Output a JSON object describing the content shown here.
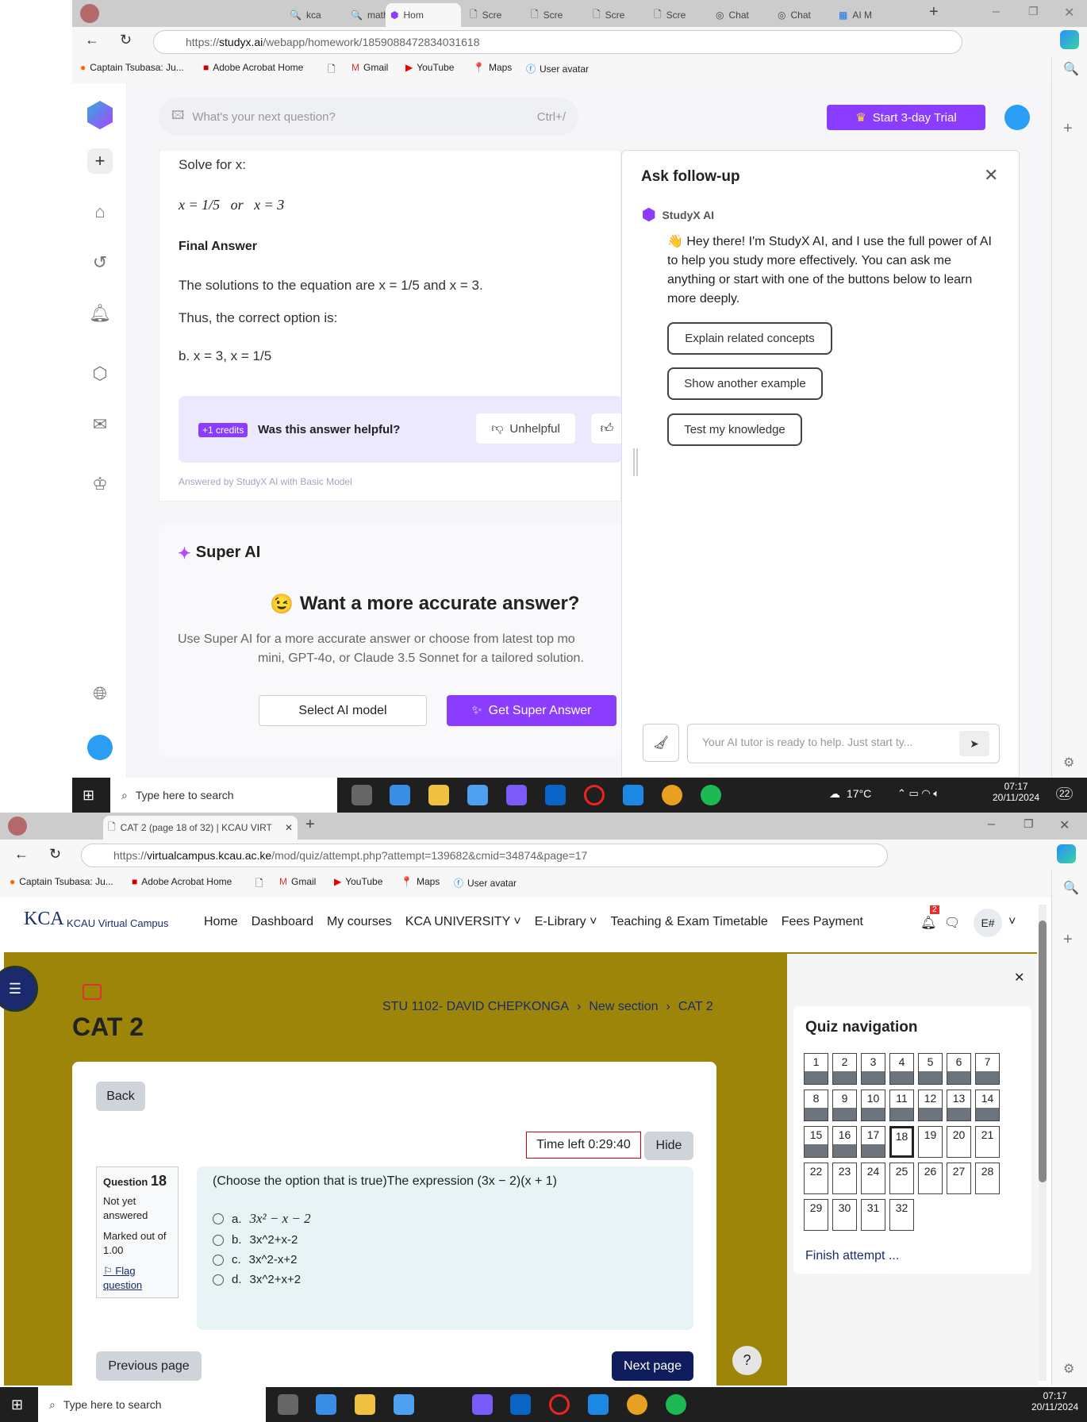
{
  "top_browser": {
    "tabs": [
      "",
      "kca",
      "math",
      "Hom",
      "Scre",
      "Scre",
      "Scre",
      "Scre",
      "Chat",
      "Chat",
      "AI M"
    ],
    "url_prefix": "https://",
    "url_domain": "studyx.ai",
    "url_path": "/webapp/homework/1859088472834031618",
    "bookmarks": [
      "Captain Tsubasa: Ju...",
      "Adobe Acrobat Home",
      "",
      "Gmail",
      "YouTube",
      "Maps",
      "User avatar"
    ]
  },
  "studyx": {
    "search_placeholder": "What's your next question?",
    "search_shortcut": "Ctrl+/",
    "trial_button": "Start 3-day Trial",
    "solve_for": "Solve for x:",
    "solutions_eq": "x = 1/5   or   x = 3",
    "final_answer_heading": "Final Answer",
    "solutions_text": "The solutions to the equation are x = 1/5 and x = 3.",
    "thus_text": "Thus, the correct option is:",
    "option_text": "b. x = 3, x = 1/5",
    "credits_badge": "+1 credits",
    "helpful_question": "Was this answer helpful?",
    "unhelpful_button": "Unhelpful",
    "answered_by": "Answered by StudyX AI with Basic Model",
    "super_ai_title": "Super AI",
    "accurate_heading": "Want a more accurate answer?",
    "super_desc_1": "Use Super AI for a more accurate answer or choose from latest top mo",
    "super_desc_2": "mini, GPT-4o, or Claude 3.5 Sonnet for a tailored solution.",
    "select_model_button": "Select AI model",
    "get_super_button": "Get Super Answer",
    "followup": {
      "title": "Ask follow-up",
      "bot_name": "StudyX AI",
      "message": "Hey there! I'm StudyX AI, and I use the full power of AI to help you study more effectively. You can ask me anything or start with one of the buttons below to learn more deeply.",
      "suggestions": [
        "Explain related concepts",
        "Show another example",
        "Test my knowledge"
      ],
      "input_placeholder": "Your AI tutor is ready to help. Just start ty..."
    },
    "accent": "#8b3dff"
  },
  "taskbar": {
    "search": "Type here to search",
    "weather": "17°C",
    "time": "07:17",
    "date": "20/11/2024",
    "notifications": "22"
  },
  "bottom_browser": {
    "tab": "CAT 2 (page 18 of 32) | KCAU VIRT",
    "url_prefix": "https://",
    "url_domain": "virtualcampus.kcau.ac.ke",
    "url_path": "/mod/quiz/attempt.php?attempt=139682&cmid=34874&page=17",
    "bookmarks": [
      "Captain Tsubasa: Ju...",
      "Adobe Acrobat Home",
      "",
      "Gmail",
      "YouTube",
      "Maps",
      "User avatar"
    ]
  },
  "kcau": {
    "site_name": "KCAU Virtual Campus",
    "logo_text": "KCA",
    "nav": [
      "Home",
      "Dashboard",
      "My courses",
      "KCA UNIVERSITY",
      "E-Library",
      "Teaching & Exam Timetable",
      "Fees Payment"
    ],
    "notif_count": "2",
    "user_initials": "E#",
    "page_title": "CAT 2",
    "breadcrumb": [
      "STU 1102- DAVID CHEPKONGA",
      "New section",
      "CAT 2"
    ],
    "back_button": "Back",
    "time_left": "Time left 0:29:40",
    "hide_button": "Hide",
    "question_label": "Question",
    "question_number": "18",
    "status": "Not yet answered",
    "marked_out_of": "Marked out of 1.00",
    "flag": "Flag question",
    "question_text": "(Choose the option that is true)The expression (3x − 2)(x + 1)",
    "options": [
      {
        "letter": "a.",
        "text": "3x² − x − 2"
      },
      {
        "letter": "b.",
        "text": "3x^2+x-2"
      },
      {
        "letter": "c.",
        "text": "3x^2-x+2"
      },
      {
        "letter": "d.",
        "text": "3x^2+x+2"
      }
    ],
    "prev_button": "Previous page",
    "next_button": "Next page",
    "help": "?",
    "quiz_nav_title": "Quiz navigation",
    "current_question": 18,
    "quiz_nav": [
      "1",
      "2",
      "3",
      "4",
      "5",
      "6",
      "7",
      "8",
      "9",
      "10",
      "11",
      "12",
      "13",
      "14",
      "15",
      "16",
      "17",
      "18",
      "19",
      "20",
      "21",
      "22",
      "23",
      "24",
      "25",
      "26",
      "27",
      "28",
      "29",
      "30",
      "31",
      "32"
    ],
    "answered_through": 17,
    "finish_attempt": "Finish attempt ...",
    "band_color": "#9c8509"
  }
}
